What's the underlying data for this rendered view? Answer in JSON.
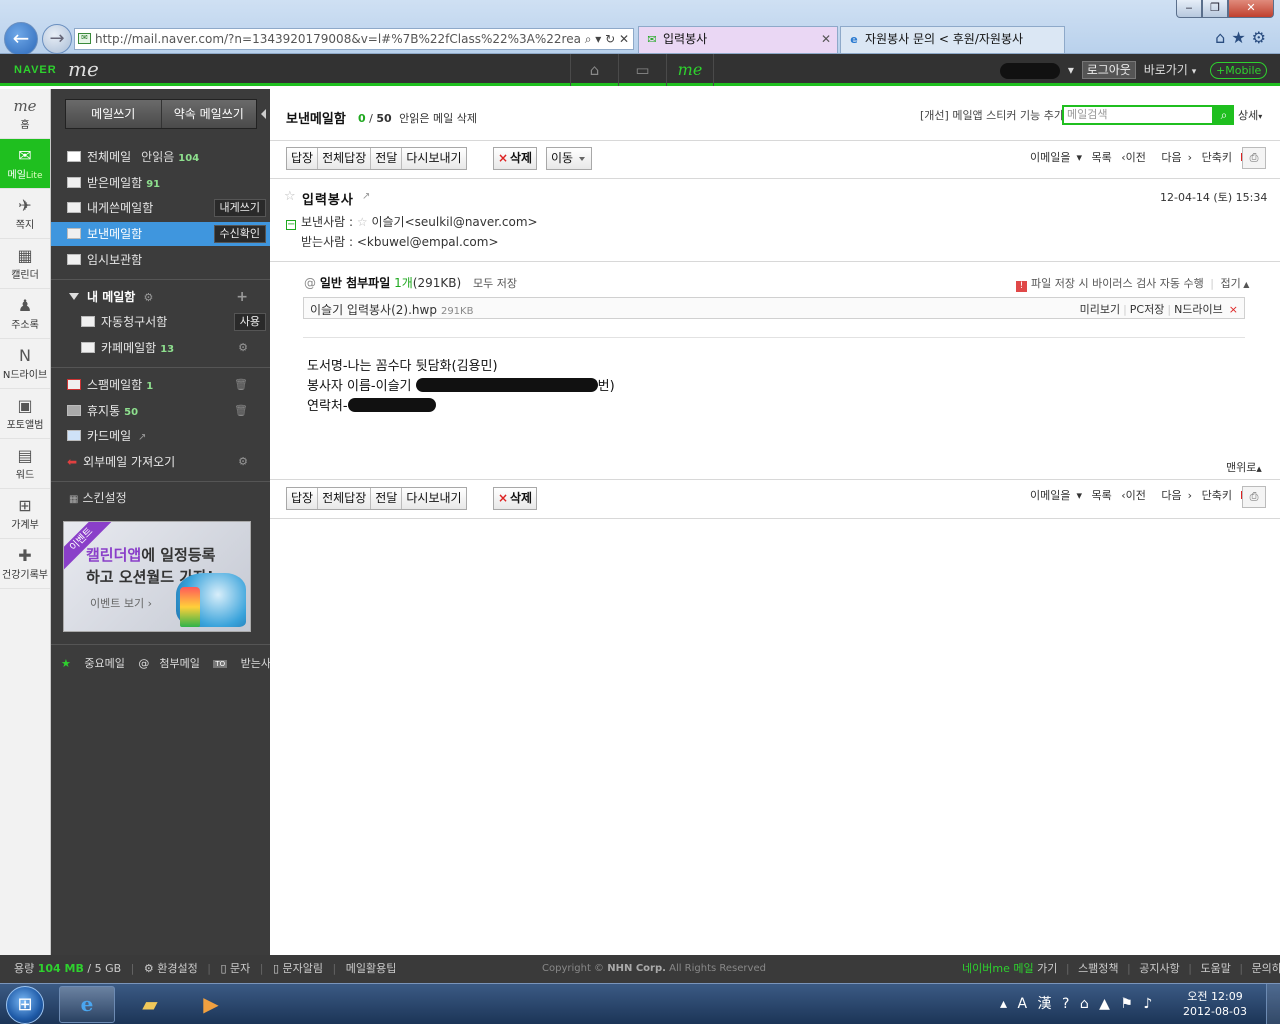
{
  "browser": {
    "url": "http://mail.naver.com/?n=1343920179008&v=l#%7B%22fClass%22%3A%22read%22",
    "addr_tools": "⌕ ▾ ↻ ✕",
    "tabs": [
      {
        "label": "입력봉사",
        "close": "✕"
      },
      {
        "label": "자원봉사 문의 < 후원/자원봉사"
      }
    ]
  },
  "naverbar": {
    "logo": "NAVER",
    "me_logo": "me",
    "me_icon": "me",
    "logout": "로그아웃",
    "shortcut": "바로가기",
    "mobile": "+Mobile"
  },
  "rail": [
    {
      "label": "홈",
      "icon": "me"
    },
    {
      "label": "메일",
      "sub": "Lite",
      "icon": "✉"
    },
    {
      "label": "쪽지",
      "icon": "✈"
    },
    {
      "label": "캘린더",
      "icon": "▦"
    },
    {
      "label": "주소록",
      "icon": "♟"
    },
    {
      "label": "N드라이브",
      "icon": "N"
    },
    {
      "label": "포토앨범",
      "icon": "▣"
    },
    {
      "label": "워드",
      "icon": "▤"
    },
    {
      "label": "가계부",
      "icon": "⊞"
    },
    {
      "label": "건강기록부",
      "icon": "✚"
    }
  ],
  "sidebar": {
    "compose": "메일쓰기",
    "compose_promise": "약속 메일쓰기",
    "all_mail": "전체메일",
    "unread_label": "안읽음",
    "unread_count": "104",
    "inbox": "받은메일함",
    "inbox_count": "91",
    "to_me": "내게쓴메일함",
    "to_me_badge": "내게쓰기",
    "sent": "보낸메일함",
    "sent_badge": "수신확인",
    "drafts": "임시보관함",
    "my_mailbox": "내 메일함",
    "auto_bill": "자동청구서함",
    "auto_bill_badge": "사용",
    "cafe": "카페메일함",
    "cafe_count": "13",
    "spam": "스팸메일함",
    "spam_count": "1",
    "trash": "휴지통",
    "trash_count": "50",
    "card": "카드메일",
    "external": "외부메일 가져오기",
    "skin": "스킨설정",
    "banner": {
      "ribbon": "이벤트",
      "line1a": "캘린더앱",
      "line1b": "에 일정등록",
      "line2": "하고 오션월드 가자!",
      "line3": "이벤트 보기 ›"
    },
    "links": [
      "중요메일",
      "첨부메일",
      "받는사람"
    ],
    "to_tag": "TO"
  },
  "main": {
    "title": "보낸메일함",
    "count_unread": "0",
    "count_total": "50",
    "delete_unread": "안읽은 메일 삭제",
    "notice": "[개선] 메일앱 스티커 기능 추가",
    "search_placeholder": "메일검색",
    "search_icon": "⌕",
    "detail": "상세",
    "buttons": [
      "답장",
      "전체답장",
      "전달",
      "다시보내기"
    ],
    "delete": "삭제",
    "move": "이동",
    "right_tools": [
      "이메일을",
      "목록",
      "이전",
      "다음",
      "단축키"
    ],
    "print_icon": "⎙",
    "subject": "입력봉사",
    "date": "12-04-14 (토) 15:34",
    "from_label": "보낸사람 :",
    "from": "이슬기<seulkil@naver.com>",
    "to_label": "받는사람 :",
    "to": "<kbuwel@empal.com>",
    "attach_title": "일반 첨부파일",
    "attach_count": "1개",
    "attach_size": "(291KB)",
    "attach_save_all": "모두 저장",
    "virus_note": "파일 저장 시 바이러스 검사 자동 수행",
    "fold": "접기",
    "file_name": "이슬기 입력봉사(2).hwp",
    "file_size": "291KB",
    "file_actions": [
      "미리보기",
      "PC저장",
      "N드라이브"
    ],
    "body_lines": [
      "도서명-나는 꼼수다 뒷담화(김용민)",
      "봉사자 이름-이슬기",
      "번)",
      "연락처-"
    ],
    "to_top": "맨위로"
  },
  "status": {
    "quota_label": "용량",
    "quota_used": "104 MB",
    "quota_total": "/ 5 GB",
    "items": [
      "환경설정",
      "문자",
      "문자알림",
      "메일활용팁"
    ],
    "copyright": "Copyright ©",
    "corp": "NHN Corp.",
    "rights": "All Rights Reserved",
    "naver_me": "네이버me 메일",
    "naver_me_go": "가기",
    "right_links": [
      "스팸정책",
      "공지사항",
      "도움말",
      "문의하기"
    ]
  },
  "taskbar": {
    "ie_icon": "e",
    "explorer_icon": "▰",
    "media_icon": "▶",
    "tray": "▴ A 漢 ? ⌂ ▲ ⚑ ♪",
    "time": "오전 12:09",
    "date": "2012-08-03"
  }
}
